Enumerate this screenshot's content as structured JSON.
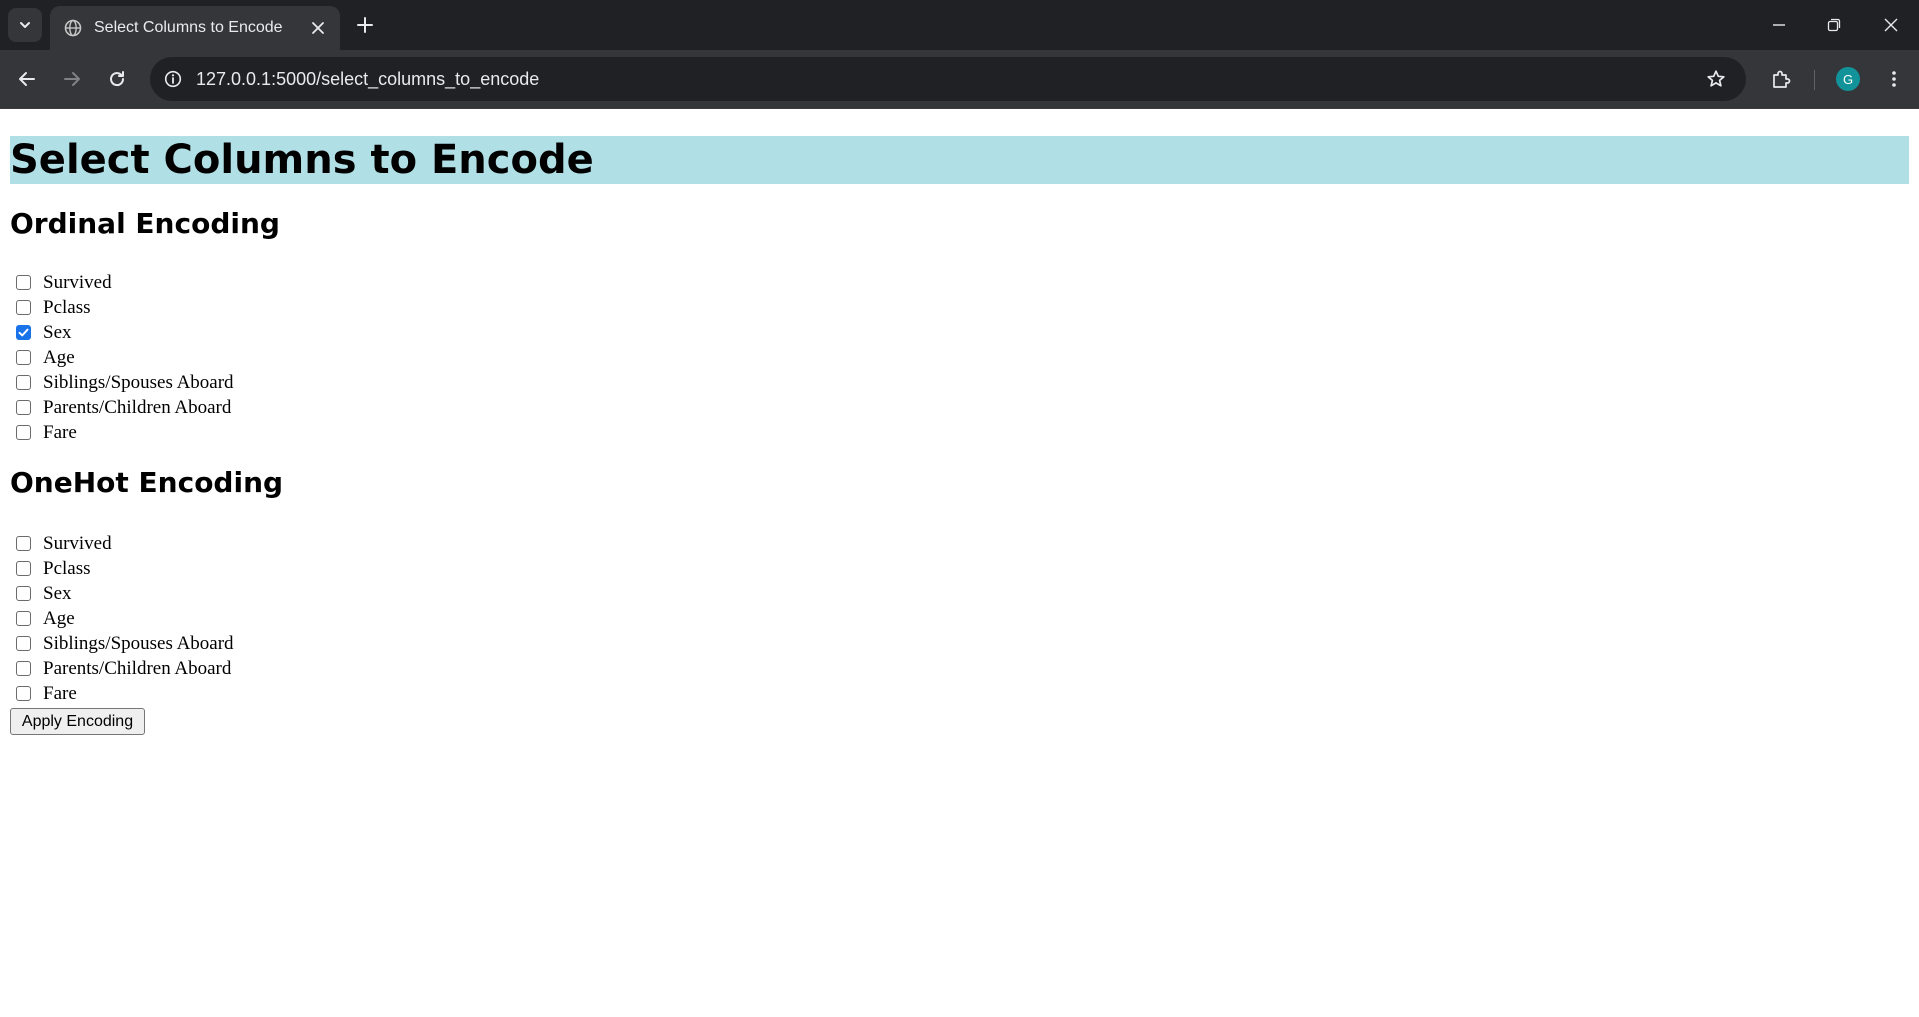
{
  "browser": {
    "tab_title": "Select Columns to Encode",
    "url": "127.0.0.1:5000/select_columns_to_encode",
    "profile_initial": "G",
    "icons": {
      "tab_search": "chevron-down-icon",
      "favicon": "globe-icon",
      "tab_close": "close-icon",
      "new_tab": "plus-icon",
      "minimize": "minimize-icon",
      "restore": "restore-icon",
      "close_window": "close-icon",
      "back": "back-arrow-icon",
      "forward": "forward-arrow-icon",
      "reload": "reload-icon",
      "site_info": "info-icon",
      "bookmark": "star-icon",
      "extensions": "puzzle-icon",
      "menu": "kebab-menu-icon"
    },
    "colors": {
      "tabbar_bg": "#202124",
      "toolbar_bg": "#35363a",
      "avatar_bg": "#12939a"
    }
  },
  "page": {
    "title": "Select Columns to Encode",
    "title_bg": "#b0e0e6",
    "ordinal": {
      "heading": "Ordinal Encoding",
      "options": [
        {
          "label": "Survived",
          "checked": false
        },
        {
          "label": "Pclass",
          "checked": false
        },
        {
          "label": "Sex",
          "checked": true
        },
        {
          "label": "Age",
          "checked": false
        },
        {
          "label": "Siblings/Spouses Aboard",
          "checked": false
        },
        {
          "label": "Parents/Children Aboard",
          "checked": false
        },
        {
          "label": "Fare",
          "checked": false
        }
      ]
    },
    "onehot": {
      "heading": "OneHot Encoding",
      "options": [
        {
          "label": "Survived",
          "checked": false
        },
        {
          "label": "Pclass",
          "checked": false
        },
        {
          "label": "Sex",
          "checked": false
        },
        {
          "label": "Age",
          "checked": false
        },
        {
          "label": "Siblings/Spouses Aboard",
          "checked": false
        },
        {
          "label": "Parents/Children Aboard",
          "checked": false
        },
        {
          "label": "Fare",
          "checked": false
        }
      ]
    },
    "submit_label": "Apply Encoding",
    "checkbox_checked_color": "#1a73e8"
  }
}
